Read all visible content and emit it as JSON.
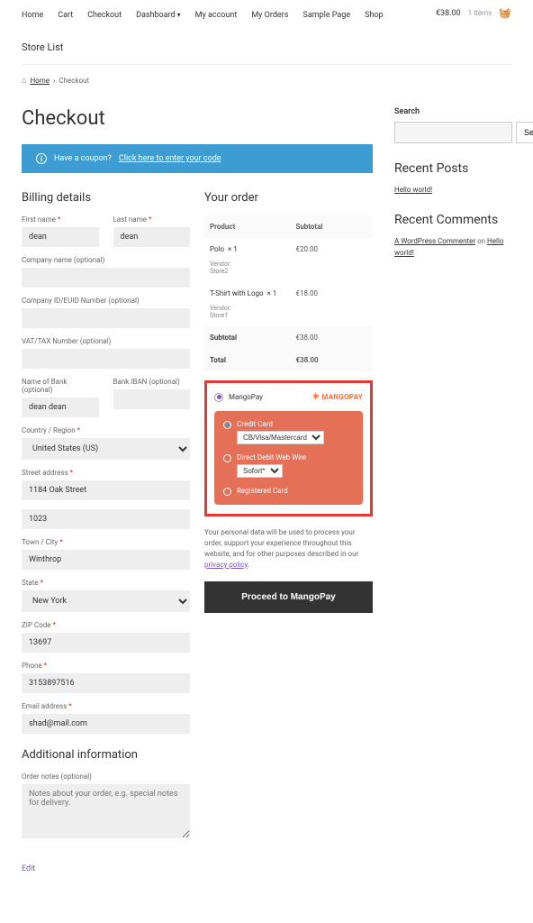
{
  "nav": {
    "items": [
      "Home",
      "Cart",
      "Checkout",
      "Dashboard",
      "My account",
      "My Orders",
      "Sample Page",
      "Shop"
    ],
    "store_list": "Store List",
    "cart_total": "€38.00",
    "cart_items": "1 Items"
  },
  "breadcrumb": {
    "home": "Home",
    "current": "Checkout"
  },
  "page_title": "Checkout",
  "coupon": {
    "q": "Have a coupon?",
    "link": "Click here to enter your code"
  },
  "billing": {
    "heading": "Billing details",
    "first_name_label": "First name",
    "first_name": "dean",
    "last_name_label": "Last name",
    "last_name": "dean",
    "company_label": "Company name (optional)",
    "company": "",
    "company_id_label": "Company ID/EUID Number (optional)",
    "company_id": "",
    "vat_label": "VAT/TAX Number (optional)",
    "vat": "",
    "bank_name_label": "Name of Bank (optional)",
    "bank_name": "dean dean",
    "iban_label": "Bank IBAN (optional)",
    "iban": "",
    "country_label": "Country / Region",
    "country": "United States (US)",
    "street_label": "Street address",
    "street1": "1184 Oak Street",
    "street2": "1023",
    "city_label": "Town / City",
    "city": "Winthrop",
    "state_label": "State",
    "state": "New York",
    "zip_label": "ZIP Code",
    "zip": "13697",
    "phone_label": "Phone",
    "phone": "3153897516",
    "email_label": "Email address",
    "email": "shad@mail.com"
  },
  "additional": {
    "heading": "Additional information",
    "notes_label": "Order notes (optional)",
    "notes_placeholder": "Notes about your order, e.g. special notes for delivery."
  },
  "edit": "Edit",
  "order": {
    "heading": "Your order",
    "col_product": "Product",
    "col_subtotal": "Subtotal",
    "items": [
      {
        "name": "Polo",
        "qty": "× 1",
        "subtotal": "€20.00",
        "vendor_label": "Vendor:",
        "vendor": "Store2"
      },
      {
        "name": "T-Shirt with Logo",
        "qty": "× 1",
        "subtotal": "€18.00",
        "vendor_label": "Vendor:",
        "vendor": "Store1"
      }
    ],
    "subtotal_label": "Subtotal",
    "subtotal": "€38.00",
    "total_label": "Total",
    "total": "€38.00"
  },
  "payment": {
    "gateway": "MangoPay",
    "logo": "MANGOPAY",
    "methods": {
      "credit": {
        "label": "Credit Card",
        "select": "CB/Visa/Mastercard"
      },
      "wire": {
        "label": "Direct Debit Web Wire",
        "select": "Sofort*"
      },
      "registered": {
        "label": "Registered Card"
      }
    },
    "privacy": "Your personal data will be used to process your order, support your experience throughout this website, and for other purposes described in our ",
    "privacy_link": "privacy policy",
    "proceed": "Proceed to MangoPay"
  },
  "sidebar": {
    "search_label": "Search",
    "search_btn": "Search",
    "recent_posts": "Recent Posts",
    "post1": "Hello world!",
    "recent_comments": "Recent Comments",
    "commenter": "A WordPress Commenter",
    "on": " on ",
    "comment_post": "Hello world!"
  }
}
